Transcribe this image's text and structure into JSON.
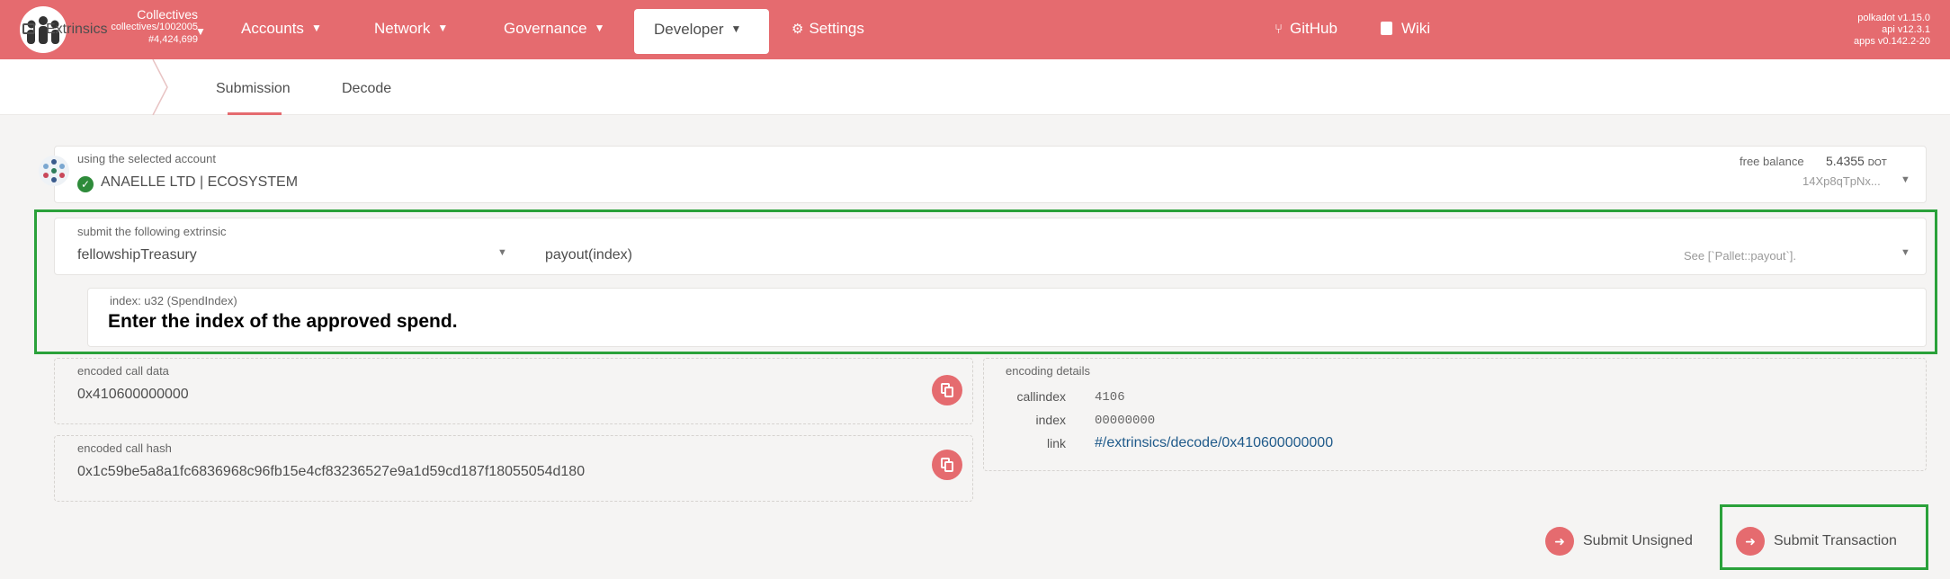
{
  "topbar": {
    "chain_name": "Collectives",
    "chain_id": "collectives/1002005",
    "block": "#4,424,699",
    "nav": [
      "Accounts",
      "Network",
      "Governance"
    ],
    "active_nav": "Developer",
    "settings": "Settings",
    "github": "GitHub",
    "wiki": "Wiki",
    "version_polkadot": "polkadot v1.15.0",
    "version_api": "api v12.3.1",
    "version_apps": "apps v0.142.2-20"
  },
  "subnav": {
    "section": "Extrinsics",
    "tabs": [
      "Submission",
      "Decode"
    ]
  },
  "account": {
    "label": "using the selected account",
    "name": "ANAELLE LTD | ECOSYSTEM",
    "balance_label": "free balance",
    "balance_value": "5.4355",
    "balance_unit": "DOT",
    "address": "14Xp8qTpNx..."
  },
  "extrinsic": {
    "label": "submit the following extrinsic",
    "pallet": "fellowshipTreasury",
    "call": "payout(index)",
    "docs": "See [`Pallet::payout`].",
    "param_label": "index: u32 (SpendIndex)",
    "param_placeholder": "Enter the index of the approved spend."
  },
  "encoded": {
    "call_data_label": "encoded call data",
    "call_data": "0x410600000000",
    "call_hash_label": "encoded call hash",
    "call_hash": "0x1c59be5a8a1fc6836968c96fb15e4cf83236527e9a1d59cd187f18055054d180"
  },
  "details": {
    "label": "encoding details",
    "callindex_key": "callindex",
    "callindex": "4106",
    "index_key": "index",
    "index": "00000000",
    "link_key": "link",
    "link": "#/extrinsics/decode/0x410600000000"
  },
  "actions": {
    "unsigned": "Submit Unsigned",
    "transaction": "Submit Transaction"
  }
}
